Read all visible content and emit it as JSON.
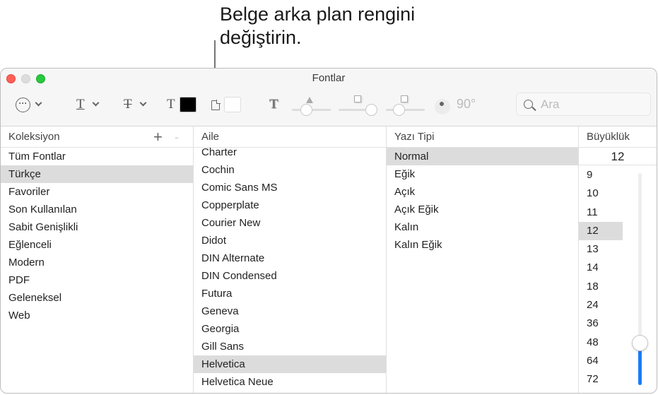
{
  "callout": {
    "text_line1": "Belge arka plan rengini",
    "text_line2": "değiştirin."
  },
  "window": {
    "title": "Fontlar"
  },
  "toolbar": {
    "more_icon": "ellipsis-circle-icon",
    "underline_glyph": "T",
    "strike_glyph": "T",
    "text_color_glyph": "T",
    "text_color": "#000000",
    "doc_bg_color": "#ffffff",
    "shadow_glyph": "T",
    "angle_label": "90°",
    "search_placeholder": "Ara",
    "search_value": ""
  },
  "collections": {
    "header": "Koleksiyon",
    "add_label": "+",
    "remove_label": "-",
    "items": [
      "Tüm Fontlar",
      "Türkçe",
      "Favoriler",
      "Son Kullanılan",
      "Sabit Genişlikli",
      "Eğlenceli",
      "Modern",
      "PDF",
      "Geleneksel",
      "Web"
    ],
    "selected": "Türkçe"
  },
  "families": {
    "header": "Aile",
    "items": [
      "Charter",
      "Cochin",
      "Comic Sans MS",
      "Copperplate",
      "Courier New",
      "Didot",
      "DIN Alternate",
      "DIN Condensed",
      "Futura",
      "Geneva",
      "Georgia",
      "Gill Sans",
      "Helvetica",
      "Helvetica Neue"
    ],
    "selected": "Helvetica"
  },
  "typefaces": {
    "header": "Yazı Tipi",
    "items": [
      "Normal",
      "Eğik",
      "Açık",
      "Açık Eğik",
      "Kalın",
      "Kalın Eğik"
    ],
    "selected": "Normal"
  },
  "sizes": {
    "header": "Büyüklük",
    "current": "12",
    "items": [
      "9",
      "10",
      "11",
      "12",
      "13",
      "14",
      "18",
      "24",
      "36",
      "48",
      "64",
      "72"
    ],
    "selected": "12",
    "slider_fraction": 0.2
  }
}
